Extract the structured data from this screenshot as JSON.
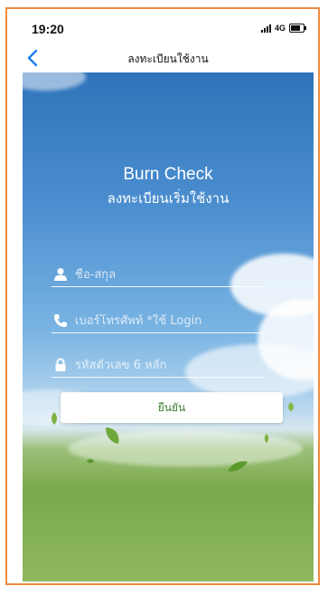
{
  "status_bar": {
    "time": "19:20",
    "network": "4G"
  },
  "nav": {
    "title": "ลงทะเบียนใช้งาน"
  },
  "hero": {
    "app_name": "Burn Check",
    "subtitle": "ลงทะเบียนเริ่มใช้งาน"
  },
  "form": {
    "name_placeholder": "ชื่อ-สกุล",
    "phone_placeholder": "เบอร์โทรศัพท์ *ใช้ Login",
    "pin_placeholder": "รหัสตัวเลข 6 หลัก",
    "confirm_label": "ยืนยัน"
  },
  "colors": {
    "frame": "#f08a3c",
    "accent_green": "#3b7b2e",
    "back_blue": "#1a7cf5"
  },
  "icons": [
    "chevron-left-icon",
    "user-icon",
    "phone-icon",
    "lock-icon"
  ]
}
